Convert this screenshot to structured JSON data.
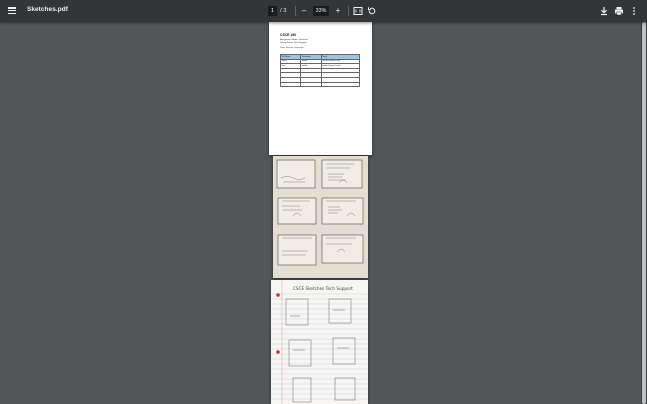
{
  "toolbar": {
    "file_name": "Sketches.pdf",
    "current_page": "1",
    "page_separator": "/",
    "total_pages": "3",
    "zoom_out_label": "–",
    "zoom_level": "33%",
    "zoom_in_label": "+"
  },
  "icons": {
    "menu": "menu-icon",
    "fit": "fit-to-page-icon",
    "rotate": "rotate-icon",
    "download": "download-icon",
    "print": "print-icon",
    "more": "more-options-icon"
  },
  "page1": {
    "heading": "CSCE 190",
    "lines": [
      "Assignment Name: Sketches",
      "Group Name: Tech Support",
      "Date: Section: Instructor:"
    ],
    "table_header": [
      "Full Name",
      "Username",
      "Email"
    ],
    "table_rows": [
      [
        "Jenna",
        "jsmith",
        "jsmith@email.sc.edu"
      ],
      [
        "Brett",
        "bmiller",
        "bmiller@email.sc.edu"
      ],
      [
        "",
        "",
        ""
      ],
      [
        "",
        "",
        ""
      ],
      [
        "",
        "",
        ""
      ],
      [
        "",
        "",
        ""
      ]
    ]
  },
  "page3": {
    "title": "CSCE Sketches Tech Support"
  },
  "colors": {
    "toolbar_bg": "#323639",
    "viewer_bg": "#525659",
    "table_header_bg": "#9cc2e5"
  }
}
